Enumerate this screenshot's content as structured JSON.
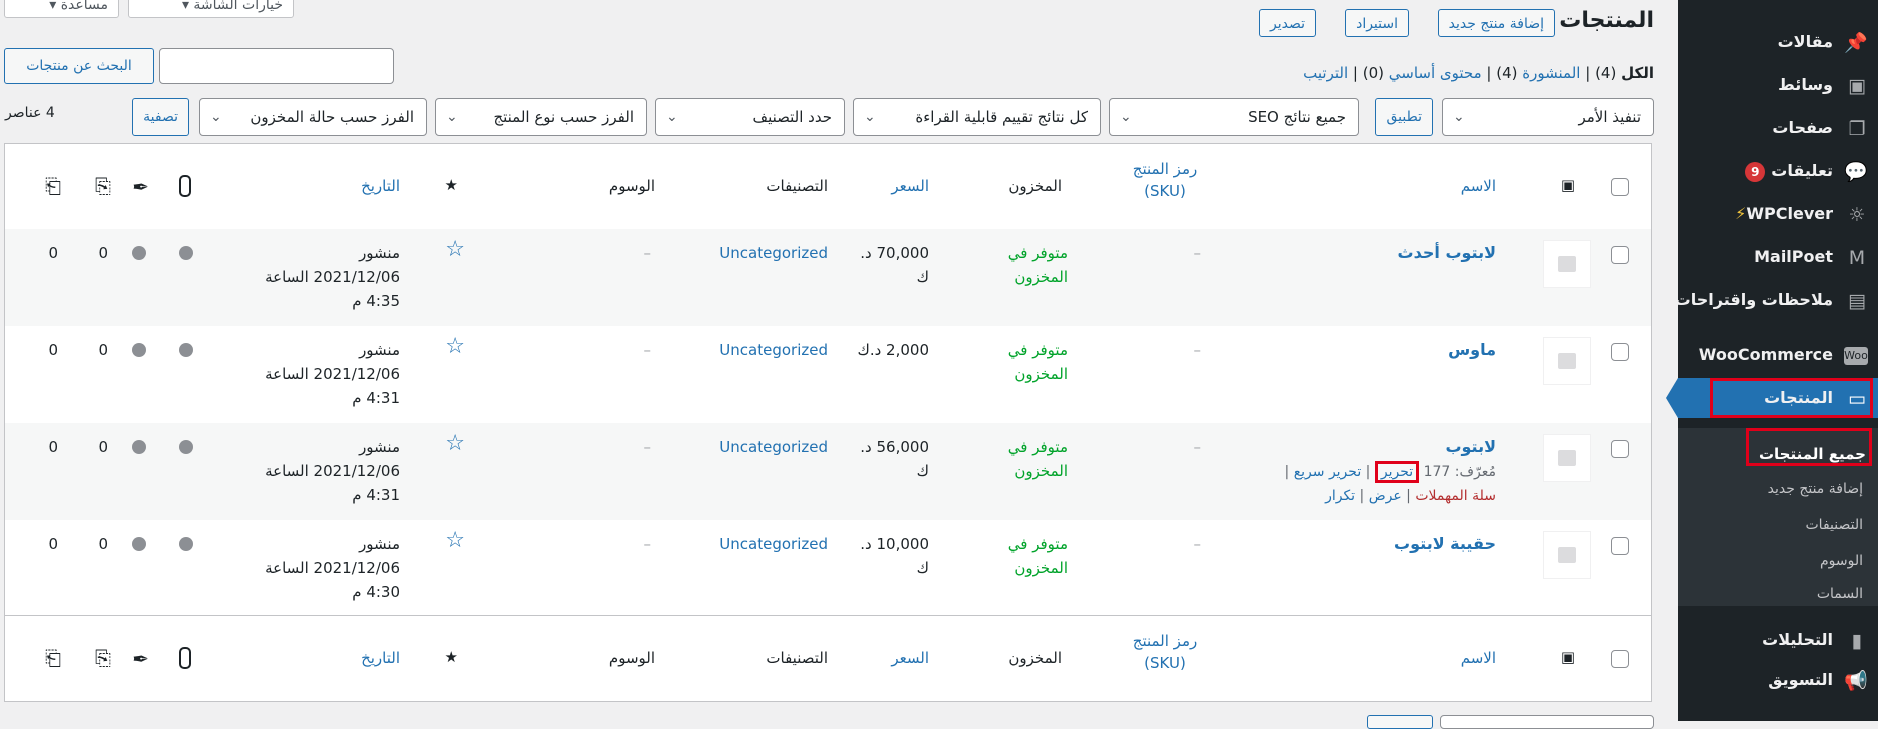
{
  "sidebar": {
    "items": [
      {
        "label": "مقالات",
        "icon": "pin-icon"
      },
      {
        "label": "وسائط",
        "icon": "media-icon"
      },
      {
        "label": "صفحات",
        "icon": "pages-icon"
      },
      {
        "label": "تعليقات",
        "icon": "comments-icon",
        "badge": "9"
      },
      {
        "label": "WPClever",
        "icon": "bulb-icon"
      },
      {
        "label": "MailPoet",
        "icon": "mailpoet-icon"
      },
      {
        "label": "ملاحظات واقتراحات",
        "icon": "feedback-icon"
      },
      {
        "label": "WooCommerce",
        "icon": "woo-icon"
      },
      {
        "label": "المنتجات",
        "icon": "archive-icon"
      },
      {
        "label": "التحليلات",
        "icon": "analytics-icon"
      },
      {
        "label": "التسويق",
        "icon": "megaphone-icon"
      }
    ],
    "submenu": [
      "جميع المنتجات",
      "إضافة منتج جديد",
      "التصنيفات",
      "الوسوم",
      "السمات"
    ]
  },
  "header": {
    "title": "المنتجات",
    "add_new": "إضافة منتج جديد",
    "import": "استيراد",
    "export": "تصدير",
    "screen_options": "خيارات الشاشة",
    "help": "مساعدة"
  },
  "views": {
    "all_label": "الكل",
    "all_count": "(4)",
    "published_label": "المنشورة",
    "published_count": "(4)",
    "cornerstone_label": "محتوى أساسي",
    "cornerstone_count": "(0)",
    "sort_label": "الترتيب"
  },
  "search": {
    "button": "البحث عن منتجات",
    "placeholder": ""
  },
  "filters": {
    "bulk_action": "تنفيذ الأمر",
    "apply": "تطبيق",
    "seo": "جميع نتائج SEO",
    "readability": "كل نتائج تقييم قابلية القراءة",
    "category": "حدد التصنيف",
    "product_type": "الفرز حسب نوع المنتج",
    "stock_status": "الفرز حسب حالة المخزون",
    "filter_button": "تصفية",
    "item_count": "4 عناصر"
  },
  "columns": {
    "name": "الاسم",
    "sku": "رمز المنتج (SKU)",
    "stock": "المخزون",
    "price": "السعر",
    "categories": "التصنيفات",
    "tags": "الوسوم",
    "date": "التاريخ"
  },
  "rows": [
    {
      "name": "لابتوب أحدث",
      "sku": "–",
      "stock1": "متوفر في",
      "stock2": "المخزون",
      "price1": "70,000 د.",
      "price2": "ك",
      "category": "Uncategorized",
      "tags": "–",
      "status": "منشور",
      "date": "2021/12/06 الساعة",
      "time": "4:35 م",
      "c1": "0",
      "c2": "0"
    },
    {
      "name": "ماوس",
      "sku": "–",
      "stock1": "متوفر في",
      "stock2": "المخزون",
      "price1": "2,000 د.ك",
      "price2": "",
      "category": "Uncategorized",
      "tags": "–",
      "status": "منشور",
      "date": "2021/12/06 الساعة",
      "time": "4:31 م",
      "c1": "0",
      "c2": "0"
    },
    {
      "name": "لابتوب",
      "sku": "–",
      "stock1": "متوفر في",
      "stock2": "المخزون",
      "price1": "56,000 د.",
      "price2": "ك",
      "category": "Uncategorized",
      "tags": "–",
      "status": "منشور",
      "date": "2021/12/06 الساعة",
      "time": "4:31 م",
      "c1": "0",
      "c2": "0",
      "id_label": "مُعرّف: 177",
      "edit": "تحرير",
      "quick_edit": "تحرير سريع",
      "trash": "سلة المهملات",
      "view": "عرض",
      "duplicate": "تكرار"
    },
    {
      "name": "حقيبة لابتوب",
      "sku": "–",
      "stock1": "متوفر في",
      "stock2": "المخزون",
      "price1": "10,000 د.",
      "price2": "ك",
      "category": "Uncategorized",
      "tags": "–",
      "status": "منشور",
      "date": "2021/12/06 الساعة",
      "time": "4:30 م",
      "c1": "0",
      "c2": "0"
    }
  ],
  "colors": {
    "sidebar": "#1d2327",
    "accent": "#2271b1",
    "highlight": "#e0001a",
    "in_stock": "#00a32a"
  }
}
